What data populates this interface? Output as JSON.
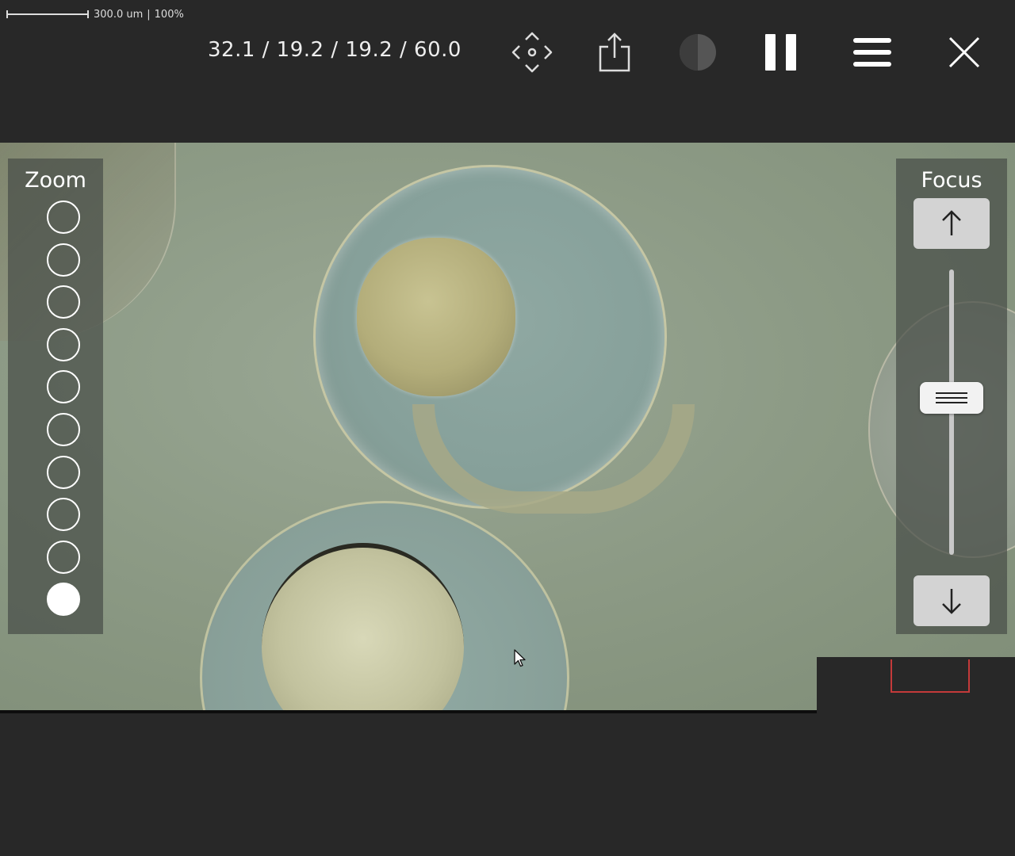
{
  "scale": {
    "length": "300.0 um",
    "separator": "|",
    "zoom": "100%"
  },
  "stats": "32.1 / 19.2 / 19.2 / 60.0",
  "toolbar": {
    "icons": [
      "move-icon",
      "share-icon",
      "contrast-icon",
      "pause-icon",
      "menu-icon",
      "close-icon"
    ]
  },
  "zoom": {
    "title": "Zoom",
    "levels": 10,
    "active_level": 10
  },
  "focus": {
    "title": "Focus",
    "up_icon": "arrow-up-icon",
    "down_icon": "arrow-down-icon",
    "handle_icon": "grip-lines-icon",
    "level_fraction": 0.55
  },
  "colors": {
    "background": "#282828",
    "minimap_viewport": "#c43a3a",
    "contrast_disabled": "#555555"
  }
}
